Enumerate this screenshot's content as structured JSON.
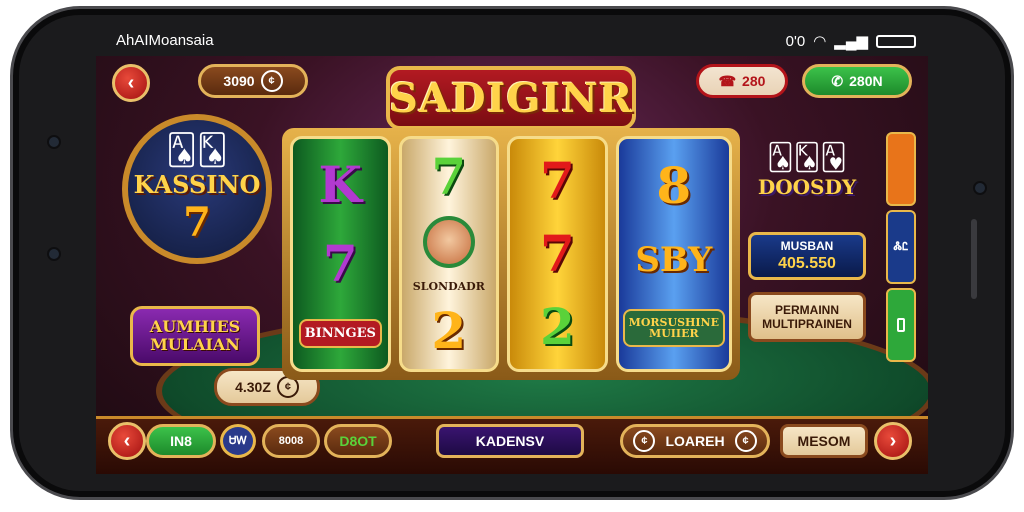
{
  "status": {
    "carrier": "AhAIMoansaia",
    "clock": "0'0"
  },
  "header": {
    "back_label": "‹",
    "coins_label": "3090",
    "title": "SADIGINR",
    "pill_red_label": "280",
    "pill_green_label": "280N"
  },
  "left": {
    "kassino_title": "KASSINO",
    "kassino_seven": "7",
    "badge_line1": "AUMHIES",
    "badge_line2": "MULAIAN",
    "bet_label": "4.30Z"
  },
  "reels": [
    {
      "top": "K",
      "mid": "7",
      "bottom": "BINNGES"
    },
    {
      "top": "7",
      "mid": "SLONDADR",
      "bottom": "2"
    },
    {
      "top": "7",
      "mid": "7",
      "bottom": "2"
    },
    {
      "top": "8",
      "mid": "SBY",
      "bottom": "MORSUSHINE MUIIER"
    }
  ],
  "right": {
    "logo": "DOOSDY",
    "panel_blue_label": "MUSBAN",
    "panel_blue_value": "405.550",
    "panel_tan_line1": "PERMAINN",
    "panel_tan_line2": "MULTIPRAINEN",
    "strip": [
      "",
      "ᏜᏝ",
      ""
    ]
  },
  "bottom": {
    "left_arrow": "‹",
    "green_label": "IN8",
    "blue_icon": "ᏌᎳ",
    "pill1_label": "8008",
    "pill2_label": "D8OT",
    "center_label": "KADENSV",
    "learn_label": "LOAREH",
    "right_label": "MESOM",
    "right_arrow": "›"
  },
  "colors": {
    "accent_gold": "#e9b84a",
    "accent_red": "#b31a22",
    "accent_green": "#2ea83a"
  }
}
